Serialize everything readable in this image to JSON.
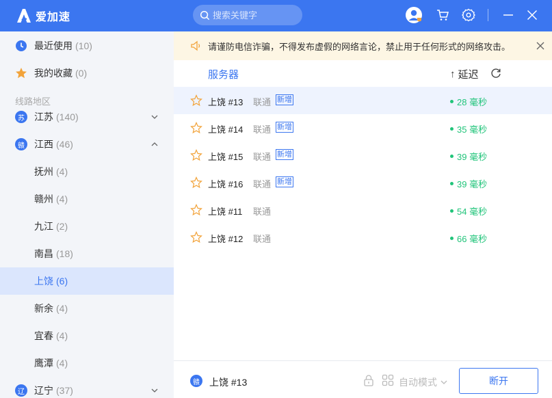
{
  "app": {
    "title": "爱加速"
  },
  "search": {
    "placeholder": "搜索关键字"
  },
  "sidebar": {
    "recent": {
      "label": "最近使用",
      "count": "(10)"
    },
    "favorites": {
      "label": "我的收藏",
      "count": "(0)"
    },
    "section_label": "线路地区",
    "regions": [
      {
        "label": "江苏",
        "count": "(140)",
        "badge": "苏"
      },
      {
        "label": "江西",
        "count": "(46)",
        "badge": "赣"
      }
    ],
    "cities": [
      {
        "label": "抚州",
        "count": "(4)"
      },
      {
        "label": "赣州",
        "count": "(4)"
      },
      {
        "label": "九江",
        "count": "(2)"
      },
      {
        "label": "南昌",
        "count": "(18)"
      },
      {
        "label": "上饶",
        "count": "(6)"
      },
      {
        "label": "新余",
        "count": "(4)"
      },
      {
        "label": "宜春",
        "count": "(4)"
      },
      {
        "label": "鹰潭",
        "count": "(4)"
      }
    ],
    "bottom_region": {
      "label": "辽宁",
      "count": "(37)",
      "badge": "辽"
    }
  },
  "notice": {
    "text": "请谨防电信诈骗，不得发布虚假的网络言论，禁止用于任何形式的网络攻击。"
  },
  "list": {
    "col_server": "服务器",
    "col_latency": "延迟",
    "sort_arrow": "↑",
    "rows": [
      {
        "name": "上饶 #13",
        "isp": "联通",
        "tag": "新增",
        "ping": "28 毫秒"
      },
      {
        "name": "上饶 #14",
        "isp": "联通",
        "tag": "新增",
        "ping": "35 毫秒"
      },
      {
        "name": "上饶 #15",
        "isp": "联通",
        "tag": "新增",
        "ping": "39 毫秒"
      },
      {
        "name": "上饶 #16",
        "isp": "联通",
        "tag": "新增",
        "ping": "39 毫秒"
      },
      {
        "name": "上饶 #11",
        "isp": "联通",
        "tag": "",
        "ping": "54 毫秒"
      },
      {
        "name": "上饶 #12",
        "isp": "联通",
        "tag": "",
        "ping": "66 毫秒"
      }
    ]
  },
  "footer": {
    "badge": "赣",
    "current_server": "上饶 #13",
    "mode_label": "自动模式",
    "disconnect_label": "断开"
  },
  "colors": {
    "accent": "#3b76f0",
    "ping": "#21c47a",
    "star": "#f2a33a",
    "notice_bg": "#fdf6e4"
  }
}
